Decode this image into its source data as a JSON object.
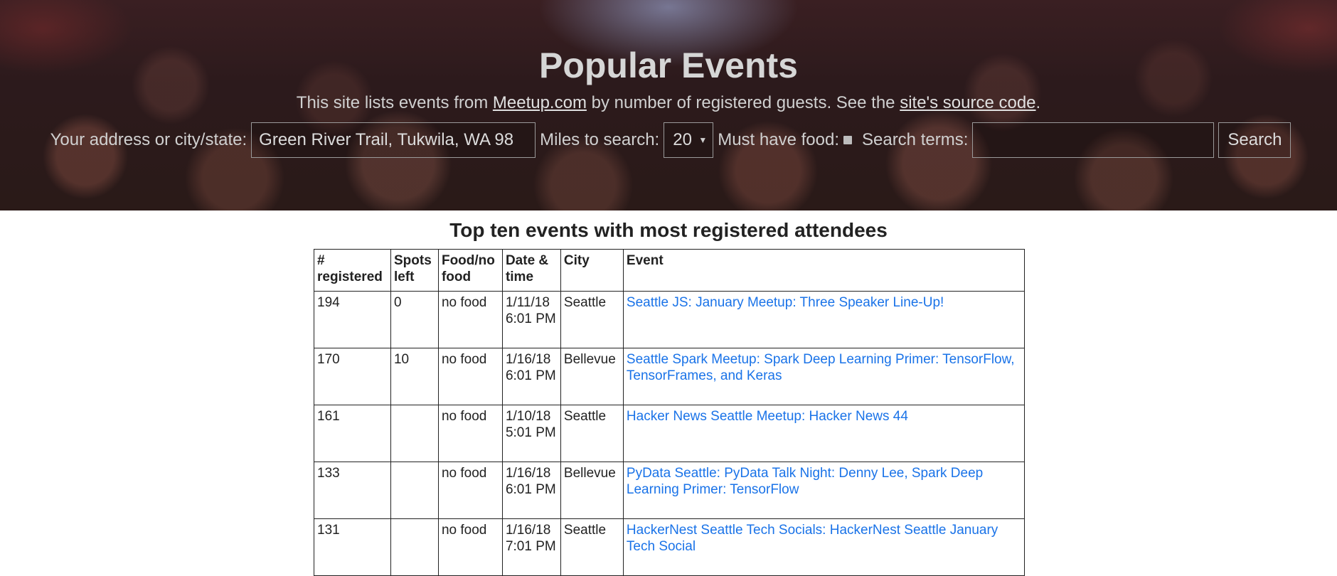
{
  "header": {
    "title": "Popular Events",
    "subtitle_prefix": "This site lists events from ",
    "meetup_link": "Meetup.com",
    "subtitle_mid": " by number of registered guests. See the ",
    "source_link": "site's source code",
    "subtitle_suffix": "."
  },
  "search_form": {
    "address_label": "Your address or city/state:",
    "address_value": "Green River Trail, Tukwila, WA 98",
    "miles_label": "Miles to search:",
    "miles_value": "20",
    "food_label": "Must have food:",
    "terms_label": "Search terms:",
    "terms_value": "",
    "search_button": "Search"
  },
  "main": {
    "title": "Top ten events with most registered attendees",
    "columns": [
      "# registered",
      "Spots left",
      "Food/no food",
      "Date & time",
      "City",
      "Event"
    ],
    "rows": [
      {
        "registered": "194",
        "spots": "0",
        "food": "no food",
        "date": "1/11/18 6:01 PM",
        "city": "Seattle",
        "event": "Seattle JS: January Meetup: Three Speaker Line-Up!"
      },
      {
        "registered": "170",
        "spots": "10",
        "food": "no food",
        "date": "1/16/18 6:01 PM",
        "city": "Bellevue",
        "event": "Seattle Spark Meetup: Spark Deep Learning Primer: TensorFlow, TensorFrames, and Keras"
      },
      {
        "registered": "161",
        "spots": "",
        "food": "no food",
        "date": "1/10/18 5:01 PM",
        "city": "Seattle",
        "event": "Hacker News Seattle Meetup: Hacker News 44"
      },
      {
        "registered": "133",
        "spots": "",
        "food": "no food",
        "date": "1/16/18 6:01 PM",
        "city": "Bellevue",
        "event": "PyData Seattle: PyData Talk Night: Denny Lee, Spark Deep Learning Primer: TensorFlow"
      },
      {
        "registered": "131",
        "spots": "",
        "food": "no food",
        "date": "1/16/18 7:01 PM",
        "city": "Seattle",
        "event": "HackerNest Seattle Tech Socials: HackerNest Seattle January Tech Social"
      }
    ]
  },
  "colors": {
    "link": "#1a73e8",
    "header_text": "#d6d6d6"
  }
}
